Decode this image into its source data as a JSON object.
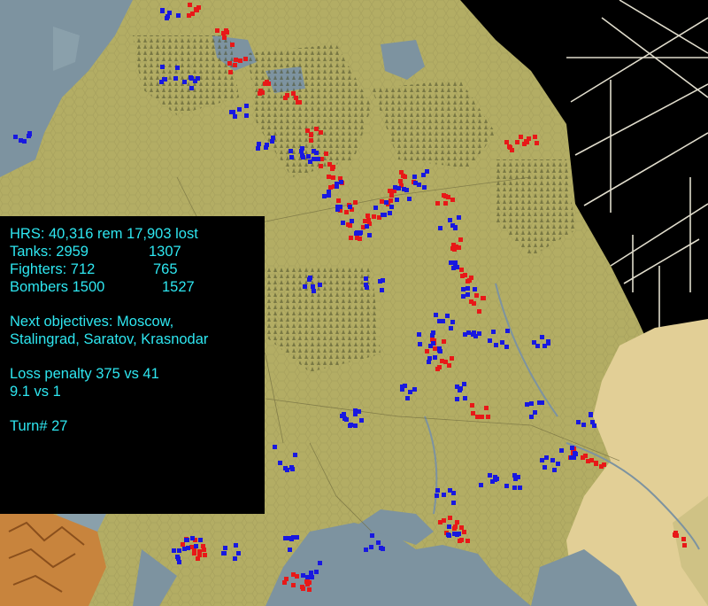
{
  "colors": {
    "panel_text": "#2ee6f0",
    "panel_bg": "#000000",
    "land": "#b3ad64",
    "steppe": "#e2cf96",
    "water": "#7d93a0",
    "axis_units": "#e81818",
    "soviet_units": "#1818e0",
    "off_map": "#000000",
    "grid": "#e0dccc"
  },
  "stats": {
    "hrs": "HRS: 40,316 rem 17,903 lost",
    "tanks": {
      "label": "Tanks: 2959",
      "lost": "1307"
    },
    "fighters": {
      "label": "Fighters: 712",
      "lost": "765"
    },
    "bombers": {
      "label": "Bombers 1500",
      "lost": "1527"
    }
  },
  "objectives": {
    "line1": "Next objectives: Moscow,",
    "line2": "Stalingrad, Saratov, Krasnodar"
  },
  "loss": {
    "line1": "Loss penalty 375 vs 41",
    "line2": "9.1 vs 1"
  },
  "turn": "Turn# 27"
}
